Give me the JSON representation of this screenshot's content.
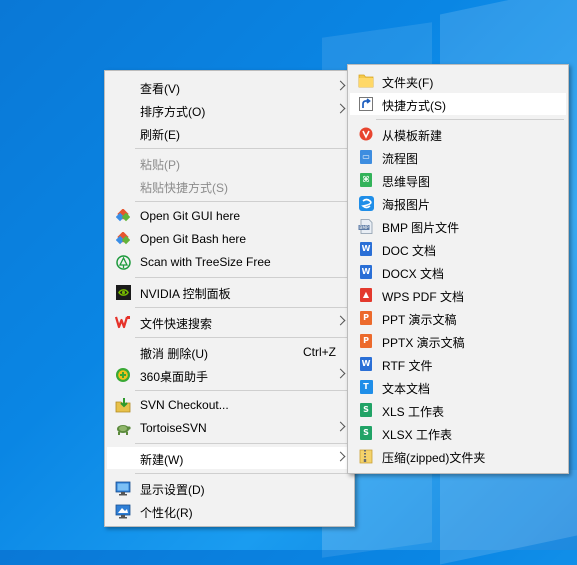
{
  "colors": {
    "desktop": "#0a84e0",
    "menu_bg": "#f2f2f2",
    "highlight": "#ffffff",
    "disabled_text": "#8c8c8c"
  },
  "context_menu": {
    "items": [
      {
        "label": "查看(V)",
        "icon": "none"
      },
      {
        "label": "排序方式(O)",
        "icon": "none"
      },
      {
        "label": "刷新(E)",
        "icon": "none"
      },
      {
        "label": "粘贴(P)",
        "icon": "none"
      },
      {
        "label": "粘贴快捷方式(S)",
        "icon": "none"
      },
      {
        "label": "Open Git GUI here",
        "icon": "git-icon"
      },
      {
        "label": "Open Git Bash here",
        "icon": "git-icon"
      },
      {
        "label": "Scan with TreeSize Free",
        "icon": "treesize-icon"
      },
      {
        "label": "NVIDIA 控制面板",
        "icon": "nvidia-icon"
      },
      {
        "label": "文件快速搜索",
        "icon": "wps-icon"
      },
      {
        "label": "撤消 删除(U)",
        "shortcut": "Ctrl+Z",
        "icon": "none"
      },
      {
        "label": "360桌面助手",
        "icon": "360-icon"
      },
      {
        "label": "SVN Checkout...",
        "icon": "svn-checkout-icon"
      },
      {
        "label": "TortoiseSVN",
        "icon": "tortoise-icon"
      },
      {
        "label": "新建(W)",
        "icon": "none"
      },
      {
        "label": "显示设置(D)",
        "icon": "display-icon"
      },
      {
        "label": "个性化(R)",
        "icon": "personalize-icon"
      }
    ]
  },
  "new_submenu": {
    "items": [
      {
        "label": "文件夹(F)",
        "icon": "folder-icon"
      },
      {
        "label": "快捷方式(S)",
        "icon": "shortcut-icon"
      },
      {
        "label": "从模板新建",
        "icon": "template-icon"
      },
      {
        "label": "流程图",
        "icon": "flowchart-icon"
      },
      {
        "label": "思维导图",
        "icon": "mindmap-icon"
      },
      {
        "label": "海报图片",
        "icon": "poster-icon"
      },
      {
        "label": "BMP 图片文件",
        "icon": "bmp-icon"
      },
      {
        "label": "DOC 文档",
        "icon": "doc-icon"
      },
      {
        "label": "DOCX 文档",
        "icon": "docx-icon"
      },
      {
        "label": "WPS PDF 文档",
        "icon": "pdf-icon"
      },
      {
        "label": "PPT 演示文稿",
        "icon": "ppt-icon"
      },
      {
        "label": "PPTX 演示文稿",
        "icon": "pptx-icon"
      },
      {
        "label": "RTF 文件",
        "icon": "rtf-icon"
      },
      {
        "label": "文本文档",
        "icon": "txt-icon"
      },
      {
        "label": "XLS 工作表",
        "icon": "xls-icon"
      },
      {
        "label": "XLSX 工作表",
        "icon": "xlsx-icon"
      },
      {
        "label": "压缩(zipped)文件夹",
        "icon": "zip-icon"
      }
    ]
  }
}
